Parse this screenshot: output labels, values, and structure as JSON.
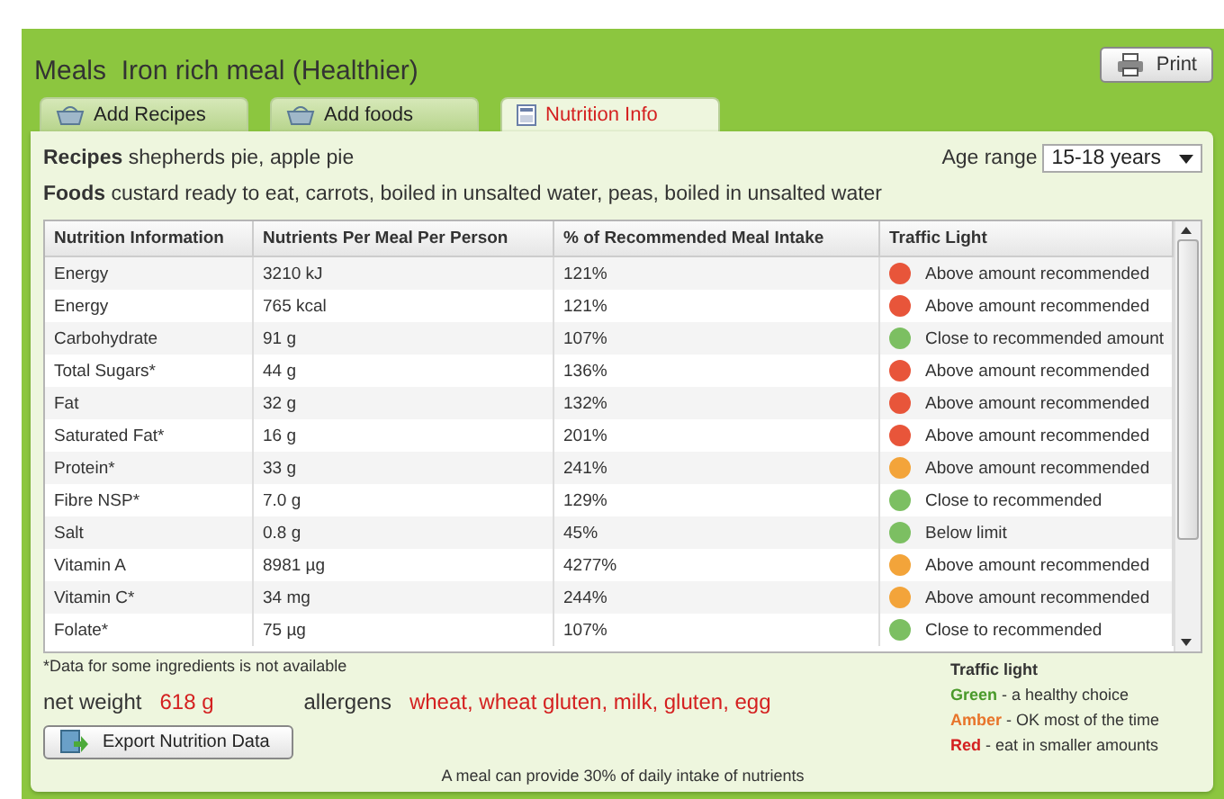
{
  "title": "Meals  Iron rich meal (Healthier)",
  "print_button": "Print",
  "tabs": [
    {
      "label": "Add Recipes",
      "selected": false
    },
    {
      "label": "Add foods",
      "selected": false
    },
    {
      "label": "Nutrition Info",
      "selected": true
    }
  ],
  "recipes": {
    "label": "Recipes",
    "value": "shepherds pie, apple pie"
  },
  "foods": {
    "label": "Foods",
    "value": "custard ready to eat, carrots, boiled in unsalted water, peas, boiled in unsalted water"
  },
  "age_range": {
    "label": "Age range",
    "value": "15-18 years"
  },
  "table": {
    "columns": [
      "Nutrition Information",
      "Nutrients Per Meal Per Person",
      "% of Recommended Meal Intake",
      "Traffic Light"
    ],
    "rows": [
      {
        "name": "Energy",
        "amount": "3210 kJ",
        "percent": "121%",
        "color": "#e8553a",
        "light": "Above amount recommended"
      },
      {
        "name": "Energy",
        "amount": "765 kcal",
        "percent": "121%",
        "color": "#e8553a",
        "light": "Above amount recommended"
      },
      {
        "name": "Carbohydrate",
        "amount": "91 g",
        "percent": "107%",
        "color": "#7cbf62",
        "light": "Close to recommended amount"
      },
      {
        "name": "Total Sugars*",
        "amount": "44 g",
        "percent": "136%",
        "color": "#e8553a",
        "light": "Above amount recommended"
      },
      {
        "name": "Fat",
        "amount": "32 g",
        "percent": "132%",
        "color": "#e8553a",
        "light": "Above amount recommended"
      },
      {
        "name": "Saturated Fat*",
        "amount": "16 g",
        "percent": "201%",
        "color": "#e8553a",
        "light": "Above amount recommended"
      },
      {
        "name": "Protein*",
        "amount": "33 g",
        "percent": "241%",
        "color": "#f3a43a",
        "light": "Above amount recommended"
      },
      {
        "name": "Fibre NSP*",
        "amount": "7.0 g",
        "percent": "129%",
        "color": "#7cbf62",
        "light": "Close to recommended"
      },
      {
        "name": "Salt",
        "amount": "0.8 g",
        "percent": "45%",
        "color": "#7cbf62",
        "light": "Below limit"
      },
      {
        "name": "Vitamin A",
        "amount": "8981 µg",
        "percent": "4277%",
        "color": "#f3a43a",
        "light": "Above amount recommended"
      },
      {
        "name": "Vitamin C*",
        "amount": "34 mg",
        "percent": "244%",
        "color": "#f3a43a",
        "light": "Above amount recommended"
      },
      {
        "name": "Folate*",
        "amount": "75 µg",
        "percent": "107%",
        "color": "#7cbf62",
        "light": "Close to recommended"
      }
    ]
  },
  "footnote": "*Data for some ingredients is not available",
  "net_weight": {
    "label": "net weight",
    "value": "618 g"
  },
  "allergens": {
    "label": "allergens",
    "value": "wheat, wheat gluten, milk, gluten, egg"
  },
  "export_button": "Export Nutrition Data",
  "legend": {
    "title": "Traffic light",
    "items": [
      {
        "name": "Green",
        "text": " - a healthy choice",
        "color": "#4a9a2a"
      },
      {
        "name": "Amber",
        "text": " - OK most of the time",
        "color": "#e8742a"
      },
      {
        "name": "Red",
        "text": " - eat in smaller amounts",
        "color": "#d42020"
      }
    ]
  },
  "bottom_note": "A meal can provide 30% of daily intake of nutrients"
}
